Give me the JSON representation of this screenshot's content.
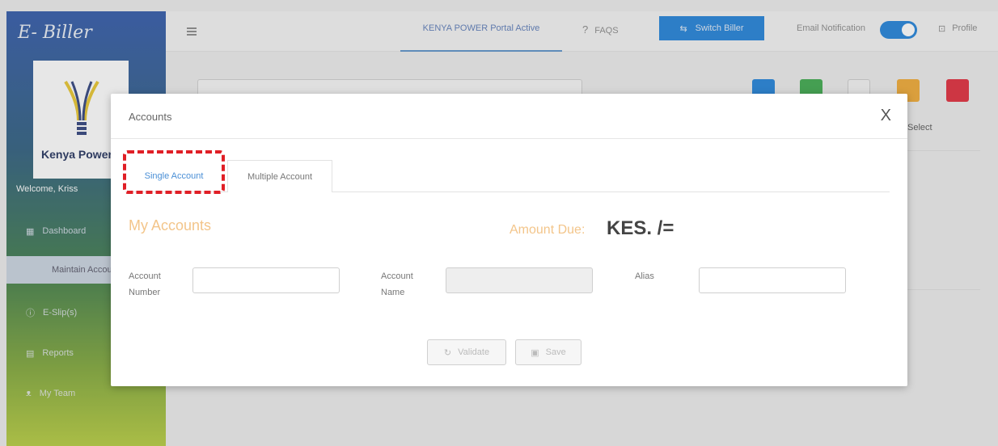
{
  "app": {
    "brand": "E- Biller",
    "logo_text": "Kenya Power",
    "welcome": "Welcome, Kriss"
  },
  "sidebar": {
    "items": [
      {
        "label": "Dashboard",
        "icon": "grid-icon"
      },
      {
        "label": "Maintain Accounts",
        "icon": ""
      },
      {
        "label": "E-Slip(s)",
        "icon": "info-circle-icon"
      },
      {
        "label": "Reports",
        "icon": "document-icon"
      },
      {
        "label": "My Team",
        "icon": "users-icon"
      }
    ]
  },
  "topbar": {
    "portal_label": "KENYA POWER Portal Active",
    "faqs_label": "FAQS",
    "switch_biller_label": "Switch Biller",
    "email_notification_label": "Email Notification",
    "email_notification_on": true,
    "profile_label": "Profile"
  },
  "background": {
    "select_label": "Select"
  },
  "modal": {
    "title": "Accounts",
    "close_symbol": "X",
    "tabs": [
      {
        "label": "Single Account",
        "active": true
      },
      {
        "label": "Multiple Account",
        "active": false
      }
    ],
    "section_title": "My Accounts",
    "amount_due_label": "Amount Due:",
    "amount_due_value": "KES. /=",
    "fields": {
      "account_number_label": "Account Number",
      "account_number_value": "",
      "account_name_label": "Account Name",
      "account_name_value": "",
      "alias_label": "Alias",
      "alias_value": ""
    },
    "validate_label": "Validate",
    "save_label": "Save"
  },
  "colors": {
    "accent_blue": "#1d7fd8",
    "highlight_red": "#e01f26",
    "amount_orange": "#f3c58a"
  }
}
